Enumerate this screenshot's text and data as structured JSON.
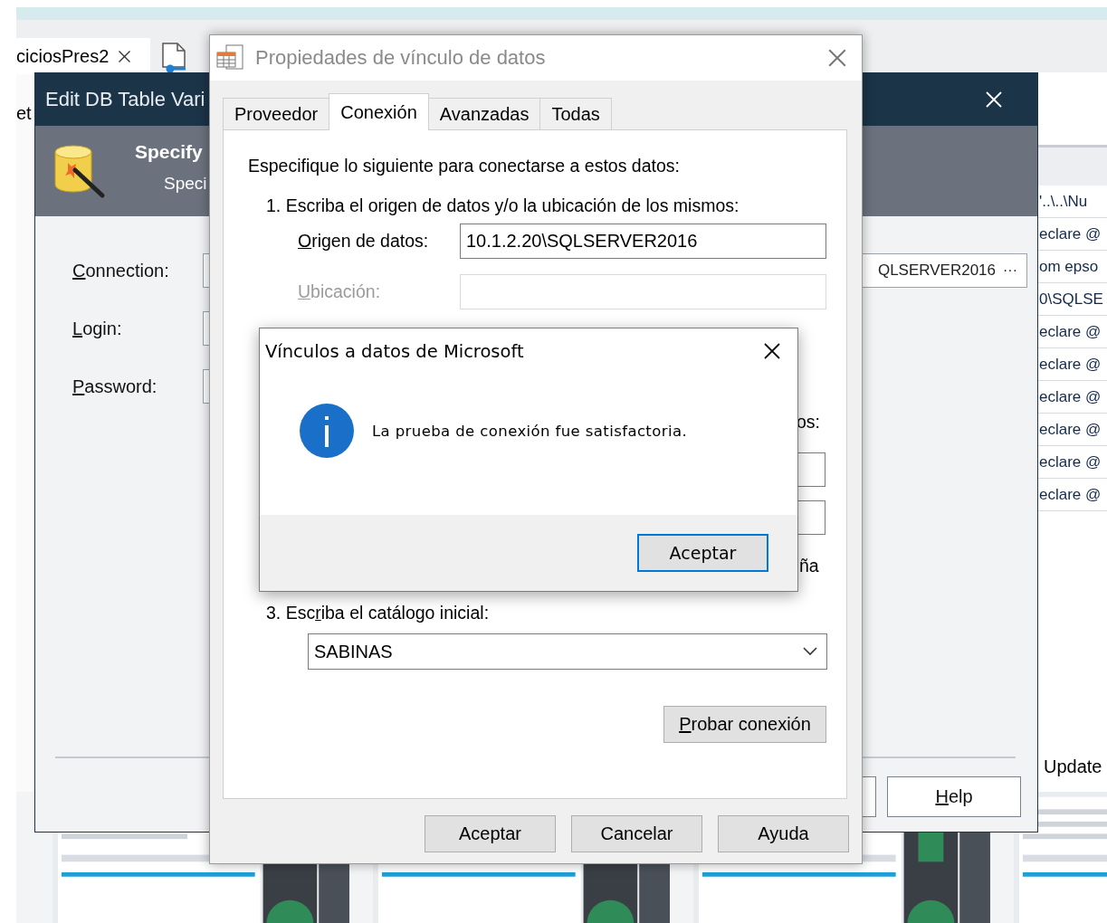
{
  "background_app": {
    "tab": {
      "label": "ciciosPres2"
    },
    "left_fragment": "et",
    "grid_cells": [
      "'..\\..\\Nu",
      "eclare @",
      "om epso",
      "0\\SQLSE",
      "eclare @",
      "eclare @",
      "eclare @",
      "eclare @",
      "eclare @",
      "eclare @"
    ],
    "update_label": "Update"
  },
  "edit_window": {
    "title": "Edit DB Table Vari",
    "header_title": "Specify",
    "header_subtitle": "Speci",
    "fields": [
      {
        "access_key": "C",
        "label_end": "onnection:",
        "value": "QLSERVER2016",
        "browse": "···"
      },
      {
        "access_key": "L",
        "label_end": "ogin:"
      },
      {
        "access_key": "P",
        "label_end": "assword:"
      }
    ],
    "help_button": {
      "access_key": "H",
      "label_end": "elp"
    }
  },
  "properties_dialog": {
    "title": "Propiedades de vínculo de datos",
    "tabs": [
      {
        "label": "Proveedor",
        "selected": false
      },
      {
        "label": "Conexión",
        "selected": true
      },
      {
        "label": "Avanzadas",
        "selected": false
      },
      {
        "label": "Todas",
        "selected": false
      }
    ],
    "intro": "Especifique lo siguiente para conectarse a estos datos:",
    "step_1": "1. Escriba el origen de datos y/o la ubicación de los mismos:",
    "step_1_fields": [
      {
        "access_key": "O",
        "label_end": "rigen de datos:",
        "value": "10.1.2.20\\SQLSERVER2016",
        "disabled": false
      },
      {
        "access_key": "U",
        "label_end": "bicación:",
        "disabled": true
      }
    ],
    "step_2_fragment": "os:",
    "checkbox_fragment": "ña",
    "step_3": {
      "label_start": "3. Esc",
      "access_key": "r",
      "label_end": "iba el catálogo inicial:"
    },
    "catalog": {
      "value": "SABINAS"
    },
    "test_button": {
      "access_key": "P",
      "label_end": "robar conexión"
    },
    "buttons": [
      {
        "label": "Aceptar"
      },
      {
        "label": "Cancelar"
      },
      {
        "label": "Ayuda"
      }
    ]
  },
  "message_box": {
    "title": "Vínculos a datos de Microsoft",
    "message": "La prueba de conexión fue satisfactoria.",
    "button": {
      "label": "Aceptar",
      "focused": true
    }
  }
}
